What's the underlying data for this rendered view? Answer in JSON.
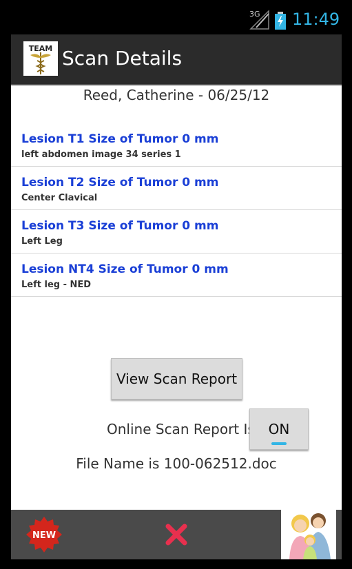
{
  "status_bar": {
    "network": "3G",
    "time": "11:49"
  },
  "action_bar": {
    "logo_text": "TEAM",
    "title": "Scan Details"
  },
  "patient_header": "Reed, Catherine - 06/25/12",
  "lesions": [
    {
      "title": "Lesion T1 Size of Tumor 0 mm",
      "subtitle": "left abdomen image 34 series 1"
    },
    {
      "title": "Lesion T2 Size of Tumor 0 mm",
      "subtitle": "Center Clavical"
    },
    {
      "title": "Lesion T3 Size of Tumor 0 mm",
      "subtitle": "Left Leg"
    },
    {
      "title": "Lesion NT4 Size of Tumor 0 mm",
      "subtitle": "Left leg - NED"
    }
  ],
  "view_button_label": "View Scan Report",
  "online_label": "Online Scan Report Is",
  "toggle_label": "ON",
  "file_name": "File Name is 100-062512.doc",
  "bottom_bar": {
    "new_label": "NEW"
  },
  "colors": {
    "accent": "#33b5e5",
    "lesion_title": "#1a3fd6",
    "action_bar": "#2b2b2b",
    "bottom_bar": "#4a4a4a",
    "delete": "#e8304e",
    "new_badge": "#d4261c"
  }
}
